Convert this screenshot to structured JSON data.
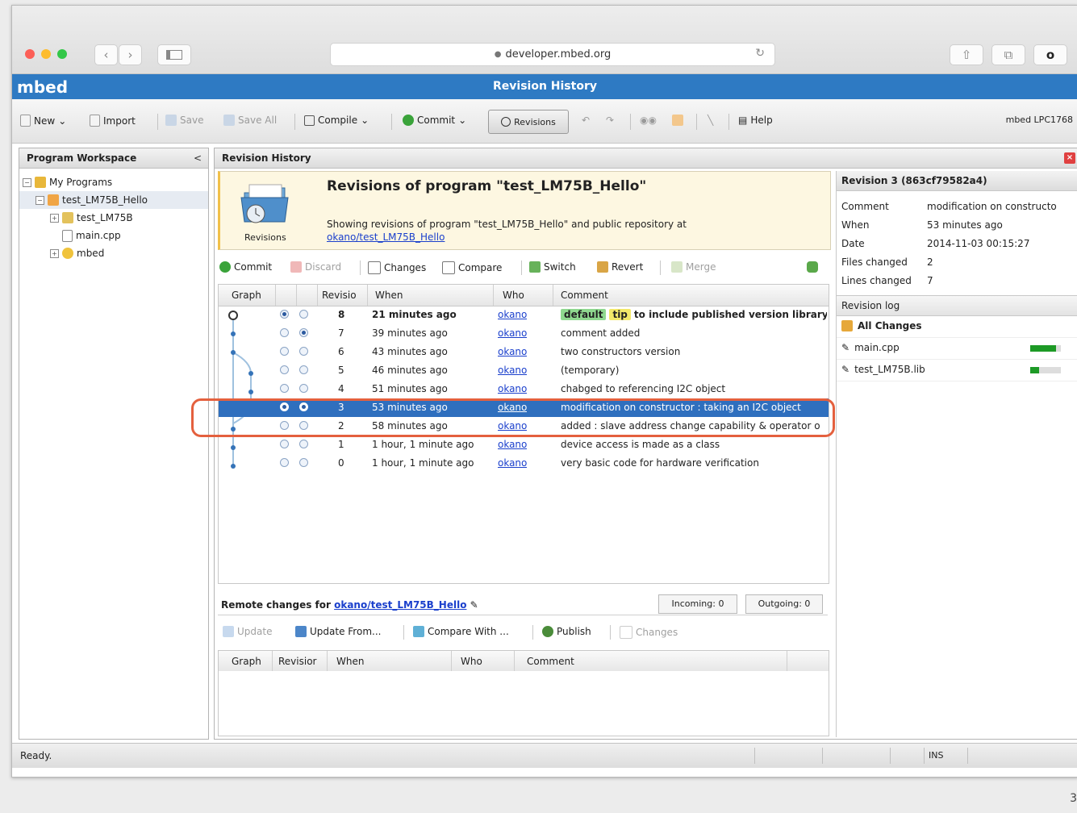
{
  "browser": {
    "address": "developer.mbed.org",
    "back_icon": "chevron-left-icon",
    "forward_icon": "chevron-right-icon"
  },
  "app": {
    "brand": "mbed",
    "title": "Revision History"
  },
  "toolbar": {
    "new": "New",
    "import": "Import",
    "save": "Save",
    "save_all": "Save All",
    "compile": "Compile",
    "commit": "Commit",
    "revisions": "Revisions",
    "help": "Help",
    "target": "mbed LPC1768"
  },
  "workspace": {
    "title": "Program Workspace",
    "collapse": "<",
    "tree": [
      {
        "label": "My Programs"
      },
      {
        "label": "test_LM75B_Hello"
      },
      {
        "label": "test_LM75B"
      },
      {
        "label": "main.cpp"
      },
      {
        "label": "mbed"
      }
    ]
  },
  "revisions": {
    "panel_title": "Revision History",
    "banner_title": "Revisions of program \"test_LM75B_Hello\"",
    "banner_icon_label": "Revisions",
    "banner_desc": "Showing revisions of program \"test_LM75B_Hello\" and public repository at",
    "banner_link": "okano/test_LM75B_Hello",
    "tools": {
      "commit": "Commit",
      "discard": "Discard",
      "changes": "Changes",
      "compare": "Compare",
      "switch": "Switch",
      "revert": "Revert",
      "merge": "Merge"
    },
    "columns": {
      "graph": "Graph",
      "revision": "Revisio",
      "when": "When",
      "who": "Who",
      "comment": "Comment"
    },
    "rows": [
      {
        "rev": "8",
        "when": "21 minutes ago",
        "who": "okano",
        "tag1": "default",
        "tag2": "tip",
        "comment": "to include published version library"
      },
      {
        "rev": "7",
        "when": "39 minutes ago",
        "who": "okano",
        "tag1": "",
        "tag2": "",
        "comment": "comment added"
      },
      {
        "rev": "6",
        "when": "43 minutes ago",
        "who": "okano",
        "tag1": "",
        "tag2": "",
        "comment": "two constructors version"
      },
      {
        "rev": "5",
        "when": "46 minutes ago",
        "who": "okano",
        "tag1": "",
        "tag2": "",
        "comment": "(temporary)"
      },
      {
        "rev": "4",
        "when": "51 minutes ago",
        "who": "okano",
        "tag1": "",
        "tag2": "",
        "comment": "chabged to referencing I2C object"
      },
      {
        "rev": "3",
        "when": "53 minutes ago",
        "who": "okano",
        "tag1": "",
        "tag2": "",
        "comment": "modification on constructor : taking an I2C object"
      },
      {
        "rev": "2",
        "when": "58 minutes ago",
        "who": "okano",
        "tag1": "",
        "tag2": "",
        "comment": "added : slave address change capability & operator o"
      },
      {
        "rev": "1",
        "when": "1 hour, 1 minute ago",
        "who": "okano",
        "tag1": "",
        "tag2": "",
        "comment": "device access is made as a class"
      },
      {
        "rev": "0",
        "when": "1 hour, 1 minute ago",
        "who": "okano",
        "tag1": "",
        "tag2": "",
        "comment": "very basic code for hardware verification"
      }
    ]
  },
  "remote": {
    "label": "Remote changes for",
    "link": "okano/test_LM75B_Hello",
    "incoming": "Incoming: 0",
    "outgoing": "Outgoing: 0",
    "tools": {
      "update": "Update",
      "update_from": "Update From...",
      "compare_with": "Compare With ...",
      "publish": "Publish",
      "changes": "Changes"
    },
    "columns": {
      "graph": "Graph",
      "revision": "Revisior",
      "when": "When",
      "who": "Who",
      "comment": "Comment"
    }
  },
  "details": {
    "title": "Revision 3 (863cf79582a4)",
    "fields": [
      {
        "key": "Comment",
        "value": "modification on constructo"
      },
      {
        "key": "When",
        "value": "53 minutes ago"
      },
      {
        "key": "Date",
        "value": "2014-11-03 00:15:27"
      },
      {
        "key": "Files changed",
        "value": "2"
      },
      {
        "key": "Lines changed",
        "value": "7"
      }
    ],
    "log_title": "Revision log",
    "log": [
      {
        "name": "All Changes",
        "level": null
      },
      {
        "name": "main.cpp",
        "level": 0.85
      },
      {
        "name": "test_LM75B.lib",
        "level": 0.3
      }
    ]
  },
  "status": {
    "text": "Ready.",
    "ins": "INS"
  },
  "page_number": "3"
}
